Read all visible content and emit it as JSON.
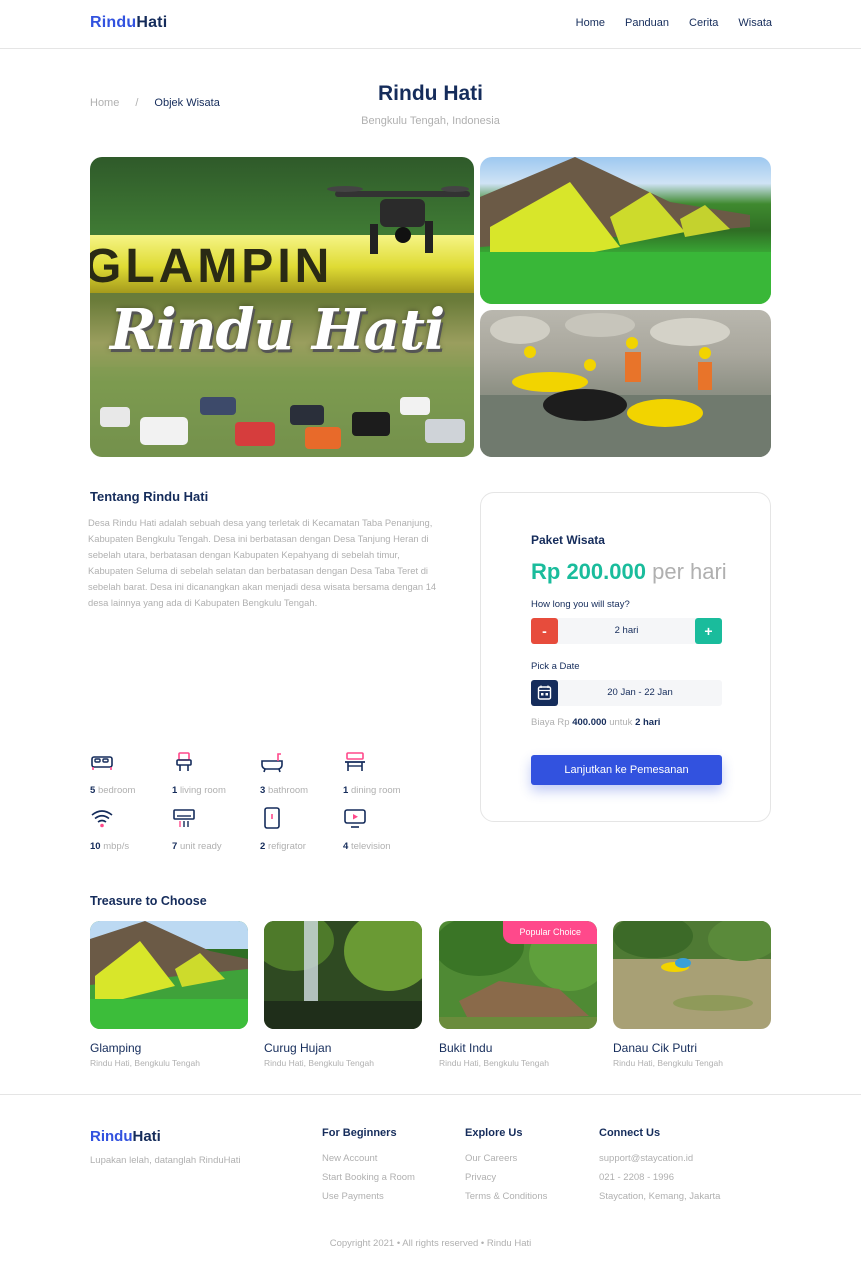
{
  "header": {
    "brand_part1": "Rindu",
    "brand_part2": "Hati",
    "nav": [
      "Home",
      "Panduan",
      "Cerita",
      "Wisata"
    ]
  },
  "breadcrumb": {
    "home": "Home",
    "separator": "/",
    "current": "Objek Wisata"
  },
  "page": {
    "title": "Rindu Hati",
    "location": "Bengkulu Tengah, Indonesia"
  },
  "gallery": {
    "main_overlay_top": "GLAMPIN",
    "main_overlay_script": "Rindu Hati"
  },
  "about": {
    "title": "Tentang Rindu Hati",
    "text": "Desa Rindu Hati adalah sebuah desa yang terletak di Kecamatan Taba Penanjung, Kabupaten Bengkulu Tengah. Desa ini berbatasan dengan Desa Tanjung Heran di sebelah utara, berbatasan dengan Kabupaten Kepahyang di sebelah timur, Kabupaten Seluma di sebelah selatan dan berbatasan dengan Desa Taba Teret di sebelah barat. Desa ini dicanangkan akan menjadi desa wisata bersama dengan 14 desa lainnya yang ada di Kabupaten Bengkulu Tengah."
  },
  "features": [
    {
      "count": "5",
      "label": "bedroom",
      "icon": "bed-icon"
    },
    {
      "count": "1",
      "label": "living room",
      "icon": "sofa-icon"
    },
    {
      "count": "3",
      "label": "bathroom",
      "icon": "bathtub-icon"
    },
    {
      "count": "1",
      "label": "dining room",
      "icon": "dining-table-icon"
    },
    {
      "count": "10",
      "label": "mbp/s",
      "icon": "wifi-icon"
    },
    {
      "count": "7",
      "label": "unit ready",
      "icon": "air-conditioner-icon"
    },
    {
      "count": "2",
      "label": "refigrator",
      "icon": "refrigerator-icon"
    },
    {
      "count": "4",
      "label": "television",
      "icon": "television-icon"
    }
  ],
  "booking": {
    "title": "Paket Wisata",
    "price": "Rp 200.000",
    "per": "per hari",
    "stay_question": "How long you will stay?",
    "minus": "-",
    "plus": "+",
    "duration": "2 hari",
    "date_label": "Pick a Date",
    "date_value": "20 Jan - 22 Jan",
    "summary_pre": "Biaya Rp",
    "summary_amount": "400.000",
    "summary_mid": "untuk",
    "summary_days": "2 hari",
    "cta": "Lanjutkan ke Pemesanan"
  },
  "treasure": {
    "title": "Treasure to Choose",
    "items": [
      {
        "name": "Glamping",
        "location": "Rindu Hati, Bengkulu Tengah",
        "badge": ""
      },
      {
        "name": "Curug Hujan",
        "location": "Rindu Hati, Bengkulu Tengah",
        "badge": ""
      },
      {
        "name": "Bukit Indu",
        "location": "Rindu Hati, Bengkulu Tengah",
        "badge": "Popular Choice"
      },
      {
        "name": "Danau Cik Putri",
        "location": "Rindu Hati, Bengkulu Tengah",
        "badge": ""
      }
    ]
  },
  "footer": {
    "brand_part1": "Rindu",
    "brand_part2": "Hati",
    "tagline": "Lupakan lelah, datanglah RinduHati",
    "columns": [
      {
        "heading": "For Beginners",
        "links": [
          "New Account",
          "Start Booking a Room",
          "Use Payments"
        ]
      },
      {
        "heading": "Explore Us",
        "links": [
          "Our Careers",
          "Privacy",
          "Terms & Conditions"
        ]
      },
      {
        "heading": "Connect Us",
        "links": [
          "support@staycation.id",
          "021 - 2208 - 1996",
          "Staycation, Kemang, Jakarta"
        ]
      }
    ],
    "copyright": "Copyright 2021 • All rights reserved • Rindu Hati"
  },
  "colors": {
    "primary": "#3252DF",
    "navy": "#152C5B",
    "teal": "#1ABC9C",
    "red": "#E74C3C",
    "pink": "#FF498B",
    "gray": "#B0B0B0"
  }
}
